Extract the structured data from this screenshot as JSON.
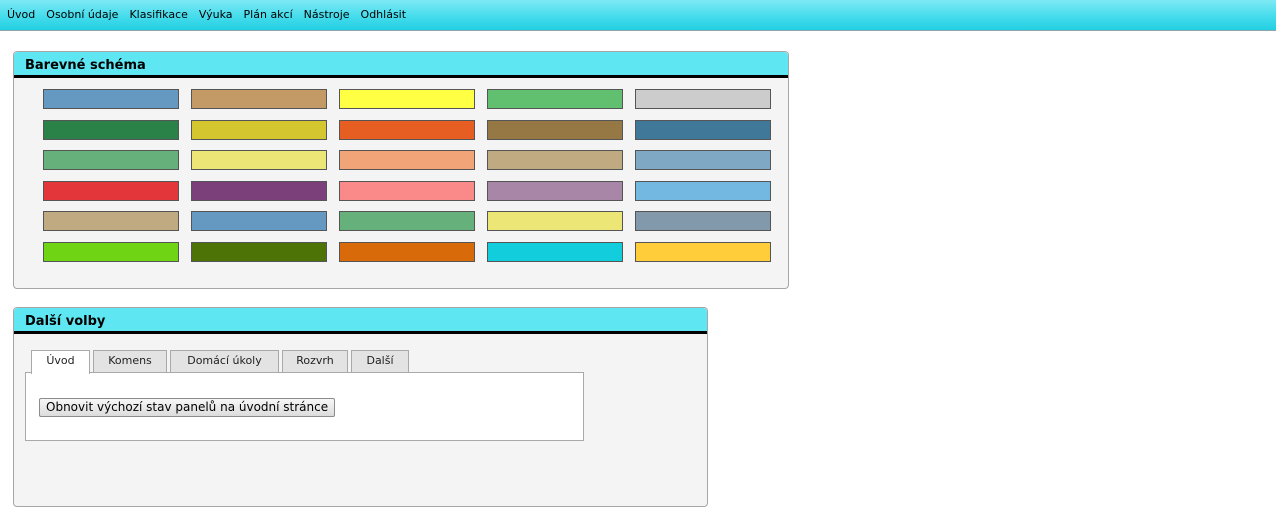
{
  "menu": [
    "Úvod",
    "Osobní údaje",
    "Klasifikace",
    "Výuka",
    "Plán akcí",
    "Nástroje",
    "Odhlásit"
  ],
  "color_panel": {
    "title": "Barevné schéma",
    "rows": [
      [
        "#6699c2",
        "#c39a65",
        "#ffff44",
        "#60c070",
        "#cccccc"
      ],
      [
        "#2a8248",
        "#d4c62e",
        "#e65e22",
        "#967844",
        "#3f7898"
      ],
      [
        "#66b07c",
        "#ece676",
        "#f2a479",
        "#bfaa82",
        "#7ea8c3"
      ],
      [
        "#e2363a",
        "#7b3f7a",
        "#fa8a8a",
        "#a886a8",
        "#72b8e0"
      ],
      [
        "#bfaa82",
        "#6699c2",
        "#66b07c",
        "#ece676",
        "#8299ac"
      ],
      [
        "#6ed414",
        "#4d7306",
        "#d96a0a",
        "#12cddc",
        "#ffcc3a"
      ]
    ]
  },
  "options_panel": {
    "title": "Další volby",
    "tabs": [
      "Úvod",
      "Komens",
      "Domácí úkoly",
      "Rozvrh",
      "Další"
    ],
    "active_tab": 0,
    "reset_button": "Obnovit výchozí stav panelů na úvodní stránce"
  }
}
